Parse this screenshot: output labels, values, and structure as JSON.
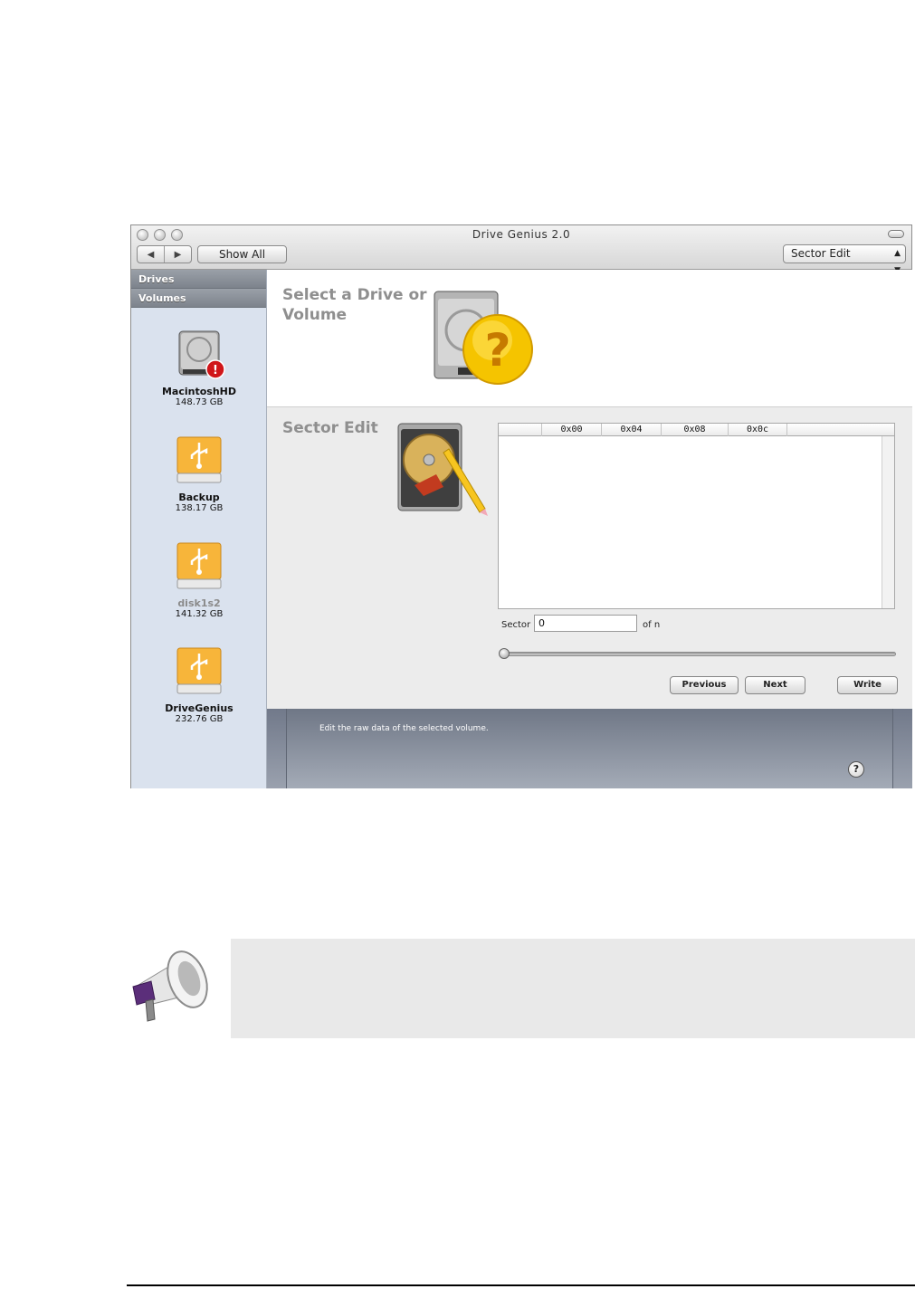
{
  "window": {
    "title": "Drive Genius 2.0",
    "nav_back": "◀",
    "nav_forward": "▶",
    "show_all_label": "Show All",
    "mode_select": "Sector Edit"
  },
  "sidebar": {
    "drives_heading": "Drives",
    "volumes_heading": "Volumes",
    "volumes": [
      {
        "name": "MacintoshHD",
        "size": "148.73 GB",
        "icon": "hard-drive-warning-icon"
      },
      {
        "name": "Backup",
        "size": "138.17 GB",
        "icon": "usb-drive-icon"
      },
      {
        "name": "disk1s2",
        "size": "141.32 GB",
        "icon": "usb-drive-icon"
      },
      {
        "name": "DriveGenius",
        "size": "232.76 GB",
        "icon": "usb-drive-icon"
      }
    ]
  },
  "select_pane": {
    "title": "Select a Drive or Volume",
    "icon": "hard-drive-question-icon"
  },
  "sector_pane": {
    "title": "Sector Edit",
    "icon": "hard-drive-pencil-icon",
    "hex_columns": [
      "0x00",
      "0x04",
      "0x08",
      "0x0c"
    ],
    "sector_label": "Sector",
    "sector_value": "0",
    "of_label": "of n",
    "slider_position": 0,
    "previous_label": "Previous",
    "next_label": "Next",
    "write_label": "Write"
  },
  "footer": {
    "description": "Edit the raw data of the selected volume.",
    "help_label": "?"
  },
  "note": {
    "icon": "megaphone-icon"
  }
}
